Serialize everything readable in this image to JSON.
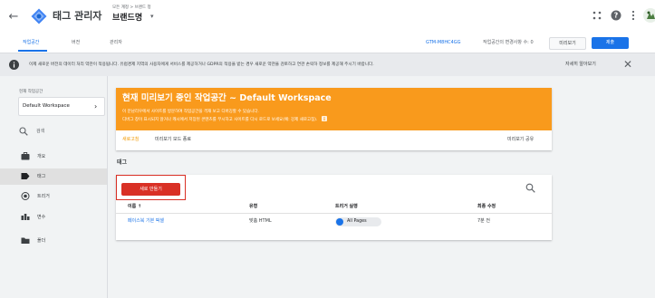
{
  "header": {
    "back_glyph": "←",
    "app_title": "태그 관리자",
    "breadcrumb": "모든 계정 > 브랜드 정",
    "account_name": "브랜드명",
    "caret": "▾"
  },
  "tabs": {
    "workspace": "작업공간",
    "versions": "버전",
    "admin": "관리자",
    "container_id": "GTM-M8HC4GG",
    "workspace_changes": "작업공간의 변경사항 수: 0",
    "preview_button": "미리보기",
    "submit_button": "제출"
  },
  "notice": {
    "text": "이제 새로운 버전의 데이터 처리 약관이 적용됩니다. 유럽경제 지역의 사용자에게 서비스를 제공하거나 GDPR의 적용을 받는 경우 새로운 약관을 검토하고 연관 손락하 정보를 제공해 주시기 바랍니다.",
    "learn_more": "자세히 알아보기",
    "close_glyph": "✕"
  },
  "sidebar": {
    "workspace_label": "현재 작업공간",
    "workspace_value": "Default Workspace",
    "workspace_chevron": "›",
    "search_label": "검색",
    "items": [
      {
        "label": "개요"
      },
      {
        "label": "태그"
      },
      {
        "label": "트리거"
      },
      {
        "label": "변수"
      },
      {
        "label": "폴더"
      }
    ]
  },
  "preview_card": {
    "title": "현재 미리보기 중인 작업공간 ~ Default Workspace",
    "line1": "이 분남리우에서 사이트를 방문하여 작업공간을 격재 보고 디버깅할 수 있습니다.",
    "line2": "디버그 창이 표시되지 않거나 캐시에서 저장된 콘텐츠를 무시하고 사이트를 다시 로드로 보세요(예: 강제 새로고침).",
    "refresh": "새로고침",
    "exit": "미리보기 모드 종료",
    "share": "미리보기 공유"
  },
  "tags_section": {
    "heading": "태그",
    "new_button": "새로 만들기",
    "columns": [
      "이름 ↑",
      "유형",
      "트리거 실행",
      "최종 수정"
    ],
    "rows": [
      {
        "name": "페이스북 기본 픽셀",
        "type": "맞춤 HTML",
        "trigger": "All Pages",
        "modified": "7분 전"
      }
    ]
  },
  "colors": {
    "accent": "#1a73e8",
    "preview_orange": "#f99a1c",
    "new_button_red": "#d93025"
  }
}
